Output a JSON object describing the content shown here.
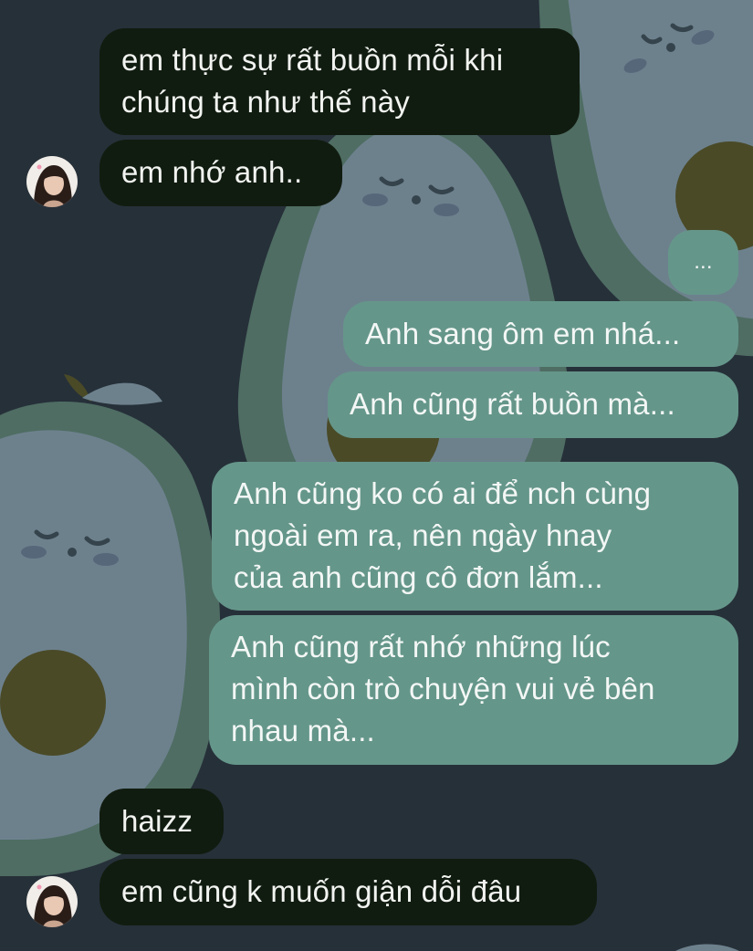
{
  "conversation": {
    "messages": [
      {
        "side": "incoming",
        "text": "em thực sự rất buồn mỗi khi\nchúng ta như thế này"
      },
      {
        "side": "incoming",
        "text": "em nhớ anh.."
      },
      {
        "side": "outgoing",
        "text": "..."
      },
      {
        "side": "outgoing",
        "text": "Anh sang ôm em nhá..."
      },
      {
        "side": "outgoing",
        "text": "Anh cũng rất buồn mà..."
      },
      {
        "side": "outgoing",
        "text": "Anh cũng ko có ai để nch cùng\nngoài em ra, nên ngày hnay\ncủa anh cũng cô đơn lắm..."
      },
      {
        "side": "outgoing",
        "text": "Anh cũng rất nhớ những lúc\nmình còn trò chuyện vui vẻ bên\nnhau mà..."
      },
      {
        "side": "incoming",
        "text": "haizz"
      },
      {
        "side": "incoming",
        "text": "em cũng k muốn giận dỗi đâu"
      }
    ]
  },
  "theme": {
    "background": "#263039",
    "incoming_bubble": "#111c10",
    "outgoing_bubble": "#65968a",
    "avocado_skin": "#4f6d63",
    "avocado_flesh": "#6d818d",
    "avocado_pit": "#4a4a27"
  },
  "icons": {
    "wallpaper": "avocado-pattern",
    "avatar": "contact-avatar-photo"
  }
}
